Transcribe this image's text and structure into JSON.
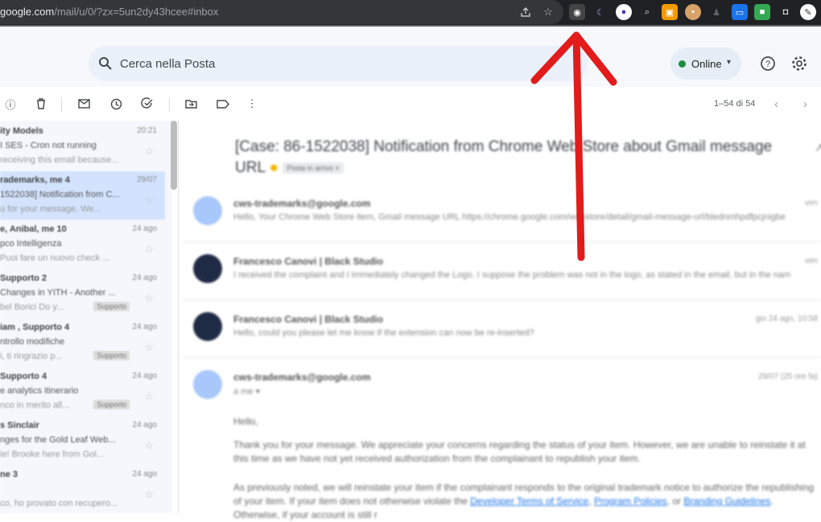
{
  "browser": {
    "url_host": "google.com",
    "url_path": "/mail/u/0/?zx=5un2dy43hcee#inbox",
    "share_icon": "share-icon",
    "bookmark_icon": "star-icon"
  },
  "header": {
    "search_placeholder": "Cerca nella Posta",
    "status_label": "Online",
    "help_icon": "help-icon",
    "settings_icon": "gear-icon"
  },
  "toolbar": {
    "page_count": "1–54 di 54"
  },
  "mail_list": [
    {
      "sender": "ity Models",
      "subject": "I SES - Cron not running",
      "snippet": "receiving this email because...",
      "date": "20:21"
    },
    {
      "sender": "rademarks, me 4",
      "subject": "1522038] Notification from C...",
      "snippet": "u for your message. We...",
      "date": "29/07",
      "selected": true
    },
    {
      "sender": "e, Anibal, me 10",
      "subject": "pco Intelligenza",
      "snippet": "Puoi fare un nuovo check ...",
      "date": "24 ago"
    },
    {
      "sender": "Supporto 2",
      "subject": "Changes in YITH - Another ...",
      "snippet": "bel Borici Do y...",
      "date": "24 ago",
      "tag": "Supporto"
    },
    {
      "sender": "iam , Supporto 4",
      "subject": "ntrollo modifiche",
      "snippet": "i, ti ringrazio p...",
      "date": "24 ago",
      "tag": "Supporto"
    },
    {
      "sender": "Supporto 4",
      "subject": "e analytics itinerario",
      "snippet": "nco in merito all...",
      "date": "24 ago",
      "tag": "Supporto"
    },
    {
      "sender": "s Sinclair",
      "subject": "nges for the Gold Leaf Web...",
      "snippet": "ie! Brooke here from Gol...",
      "date": "24 ago"
    },
    {
      "sender": "ne 3",
      "subject": "",
      "snippet": "co, ho provato con recupero...",
      "date": "24 ago"
    }
  ],
  "reading": {
    "subject": "[Case: 86-1522038] Notification from Chrome Web Store about Gmail message URL",
    "label": "Posta in arrivo ×",
    "messages": [
      {
        "from": "cws-trademarks@google.com",
        "snippet": "Hello, Your Chrome Web Store item, Gmail message URL https://chrome.google.com/webstore/detail/gmail-message-url/blednmhpdfpcjnigbe",
        "when": "ven"
      },
      {
        "from": "Francesco Canovi | Black Studio",
        "snippet": "I received the complaint and I immediately changed the Logo. I suppose the problem was not in the logo, as stated in the email, but in the nam",
        "when": "ven"
      },
      {
        "from": "Francesco Canovi | Black Studio",
        "snippet": "Hello, could you please let me know if the extension can now be re-inserted?",
        "when": "gio 24 ago, 10:58"
      },
      {
        "from": "cws-trademarks@google.com",
        "snippet": "a me ▾",
        "when": "29/07 (25 ore fa)"
      }
    ],
    "body_greeting": "Hello,",
    "body_p1": "Thank you for your message. We appreciate your concerns regarding the status of your item. However, we are unable to reinstate it at this time as we have not yet received authorization from the complainant to republish your item.",
    "body_p2_start": "As previously noted, we will reinstate your item if the complainant responds to the original trademark notice to authorize the republishing of your item. If your item does not otherwise violate the ",
    "link1": "Developer Terms of Service",
    "link2": "Program Policies",
    "link3": "Branding Guidelines",
    "body_p2_end": ". Otherwise, if your account is still r"
  }
}
